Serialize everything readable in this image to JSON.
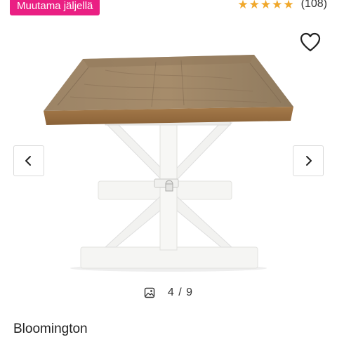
{
  "badge": {
    "text": "Muutama jäljellä",
    "color": "#ea1f83"
  },
  "rating": {
    "stars": [
      "★",
      "★",
      "★",
      "★",
      "★"
    ],
    "count_label": "(108)",
    "star_color": "#f0a82c"
  },
  "favorite": {
    "icon": "heart-outline-icon"
  },
  "gallery": {
    "prev_icon": "chevron-left-icon",
    "next_icon": "chevron-right-icon",
    "image_icon": "image-icon",
    "counter": "4 / 9"
  },
  "product": {
    "title": "Bloomington"
  }
}
